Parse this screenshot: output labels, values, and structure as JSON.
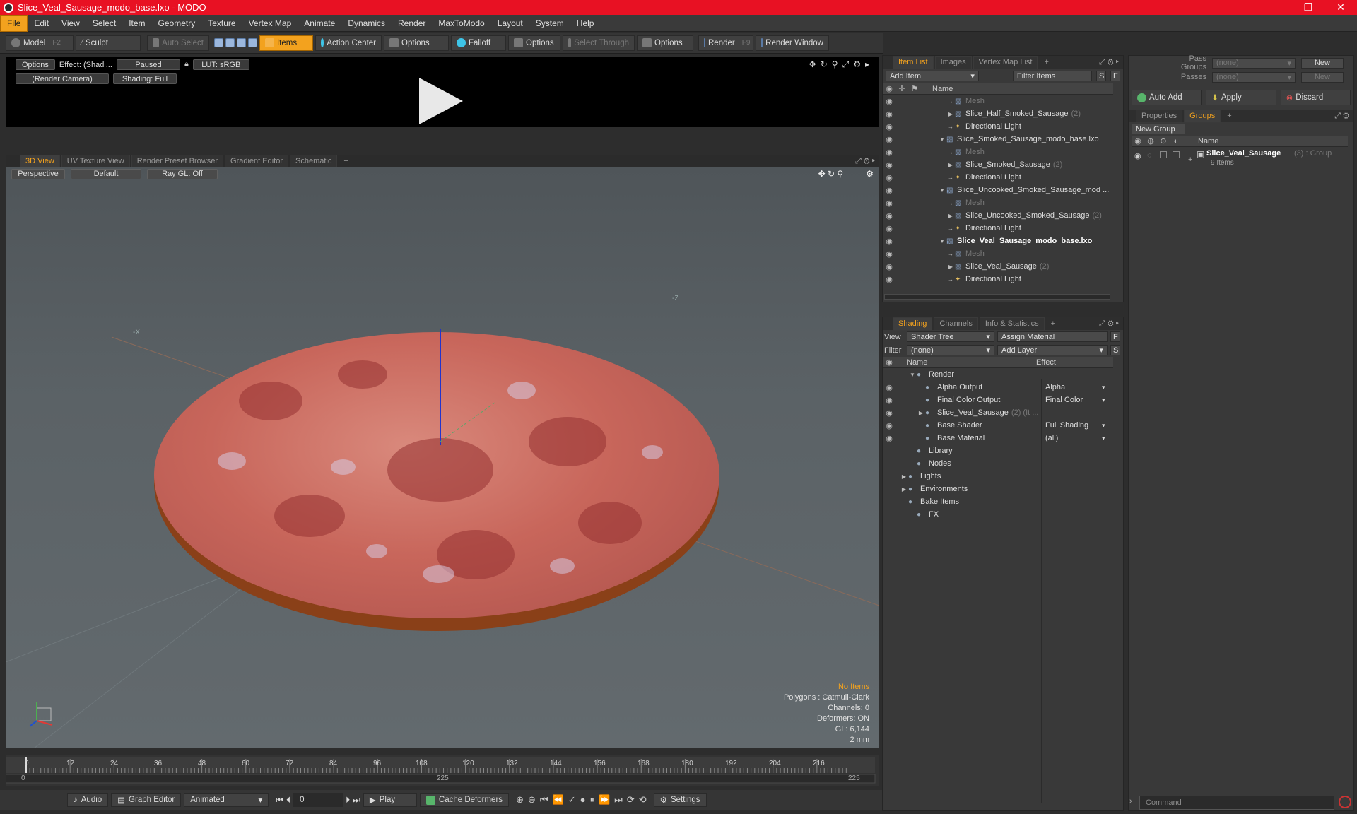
{
  "window": {
    "title": "Slice_Veal_Sausage_modo_base.lxo - MODO",
    "controls": [
      "—",
      "❐",
      "✕"
    ]
  },
  "menu": [
    "File",
    "Edit",
    "View",
    "Select",
    "Item",
    "Geometry",
    "Texture",
    "Vertex Map",
    "Animate",
    "Dynamics",
    "Render",
    "MaxToModo",
    "Layout",
    "System",
    "Help"
  ],
  "toolbar": {
    "model": "Model",
    "model_key": "F2",
    "sculpt": "Sculpt",
    "auto_select": "Auto Select",
    "items": "Items",
    "action_center": "Action Center",
    "options1": "Options",
    "falloff": "Falloff",
    "options2": "Options",
    "select_through": "Select Through",
    "options3": "Options",
    "render": "Render",
    "render_key": "F9",
    "render_window": "Render Window"
  },
  "preview": {
    "options": "Options",
    "effect": "Effect: (Shadi...",
    "paused": "Paused",
    "lut": "LUT: sRGB",
    "camera": "(Render Camera)",
    "shading": "Shading: Full"
  },
  "viewport_tabs": [
    "3D View",
    "UV Texture View",
    "Render Preset Browser",
    "Gradient Editor",
    "Schematic",
    "+"
  ],
  "viewport": {
    "perspective": "Perspective",
    "default": "Default",
    "raygl": "Ray GL: Off",
    "axis_labels": {
      "neg_x": "-X",
      "neg_z": "-Z"
    }
  },
  "viewport_info": {
    "no_items": "No Items",
    "polygons": "Polygons : Catmull-Clark",
    "channels": "Channels: 0",
    "deformers": "Deformers: ON",
    "gl": "GL: 6,144",
    "scale": "2 mm"
  },
  "timeline": {
    "ticks": [
      "0",
      "12",
      "24",
      "36",
      "48",
      "60",
      "72",
      "84",
      "96",
      "108",
      "120",
      "132",
      "144",
      "156",
      "168",
      "180",
      "192",
      "204",
      "216"
    ],
    "start": "0",
    "mid": "225",
    "end": "225"
  },
  "bottom": {
    "audio": "Audio",
    "graph_editor": "Graph Editor",
    "animated": "Animated",
    "frame": "0",
    "play": "Play",
    "cache_deformers": "Cache Deformers",
    "settings": "Settings"
  },
  "item_list": {
    "tabs": [
      "Item List",
      "Images",
      "Vertex Map List",
      "+"
    ],
    "add_item": "Add Item",
    "filter_items": "Filter Items",
    "s": "S",
    "f": "F",
    "col_name": "Name",
    "rows": [
      {
        "label": "Mesh",
        "indent": 3,
        "dim": true,
        "arrow": ""
      },
      {
        "label": "Slice_Half_Smoked_Sausage",
        "count": "(2)",
        "indent": 3,
        "arrow": "▶"
      },
      {
        "label": "Directional Light",
        "indent": 3,
        "arrow": ""
      },
      {
        "label": "Slice_Smoked_Sausage_modo_base.lxo",
        "indent": 2,
        "arrow": "▼"
      },
      {
        "label": "Mesh",
        "indent": 3,
        "dim": true,
        "arrow": ""
      },
      {
        "label": "Slice_Smoked_Sausage",
        "count": "(2)",
        "indent": 3,
        "arrow": "▶"
      },
      {
        "label": "Directional Light",
        "indent": 3,
        "arrow": ""
      },
      {
        "label": "Slice_Uncooked_Smoked_Sausage_mod ...",
        "indent": 2,
        "arrow": "▼"
      },
      {
        "label": "Mesh",
        "indent": 3,
        "dim": true,
        "arrow": ""
      },
      {
        "label": "Slice_Uncooked_Smoked_Sausage",
        "count": "(2)",
        "indent": 3,
        "arrow": "▶"
      },
      {
        "label": "Directional Light",
        "indent": 3,
        "arrow": ""
      },
      {
        "label": "Slice_Veal_Sausage_modo_base.lxo",
        "indent": 2,
        "arrow": "▼",
        "bold": true
      },
      {
        "label": "Mesh",
        "indent": 3,
        "dim": true,
        "arrow": ""
      },
      {
        "label": "Slice_Veal_Sausage",
        "count": "(2)",
        "indent": 3,
        "arrow": "▶"
      },
      {
        "label": "Directional Light",
        "indent": 3,
        "arrow": ""
      }
    ]
  },
  "shading": {
    "tabs": [
      "Shading",
      "Channels",
      "Info & Statistics",
      "+"
    ],
    "view_label": "View",
    "view_value": "Shader Tree",
    "assign_material": "Assign Material",
    "f": "F",
    "filter_label": "Filter",
    "filter_value": "(none)",
    "add_layer": "Add Layer",
    "s": "S",
    "col_name": "Name",
    "col_effect": "Effect",
    "rows": [
      {
        "label": "Render",
        "effect": "",
        "indent": 1,
        "arrow": "▼",
        "eye": false
      },
      {
        "label": "Alpha Output",
        "effect": "Alpha",
        "indent": 2,
        "eye": true
      },
      {
        "label": "Final Color Output",
        "effect": "Final Color",
        "indent": 2,
        "eye": true
      },
      {
        "label": "Slice_Veal_Sausage",
        "count": "(2) (It ...",
        "effect": "",
        "indent": 2,
        "arrow": "▶",
        "eye": true
      },
      {
        "label": "Base Shader",
        "effect": "Full Shading",
        "indent": 2,
        "eye": true
      },
      {
        "label": "Base Material",
        "effect": "(all)",
        "indent": 2,
        "eye": true
      },
      {
        "label": "Library",
        "effect": "",
        "indent": 1,
        "eye": false
      },
      {
        "label": "Nodes",
        "effect": "",
        "indent": 1,
        "eye": false
      },
      {
        "label": "Lights",
        "effect": "",
        "indent": 0,
        "arrow": "▶",
        "eye": false
      },
      {
        "label": "Environments",
        "effect": "",
        "indent": 0,
        "arrow": "▶",
        "eye": false
      },
      {
        "label": "Bake Items",
        "effect": "",
        "indent": 0,
        "eye": false
      },
      {
        "label": "FX",
        "effect": "",
        "indent": 1,
        "eye": false
      }
    ]
  },
  "right_panel": {
    "pass_groups": "Pass Groups",
    "pass_groups_value": "(none)",
    "new": "New",
    "passes": "Passes",
    "passes_value": "(none)",
    "new2": "New",
    "auto_add": "Auto Add",
    "apply": "Apply",
    "discard": "Discard",
    "tabs": [
      "Properties",
      "Groups",
      "+"
    ],
    "new_group": "New Group",
    "col_name": "Name",
    "group_name": "Slice_Veal_Sausage",
    "group_count": "(3) : Group",
    "group_items": "9 Items",
    "command_placeholder": "Command"
  }
}
